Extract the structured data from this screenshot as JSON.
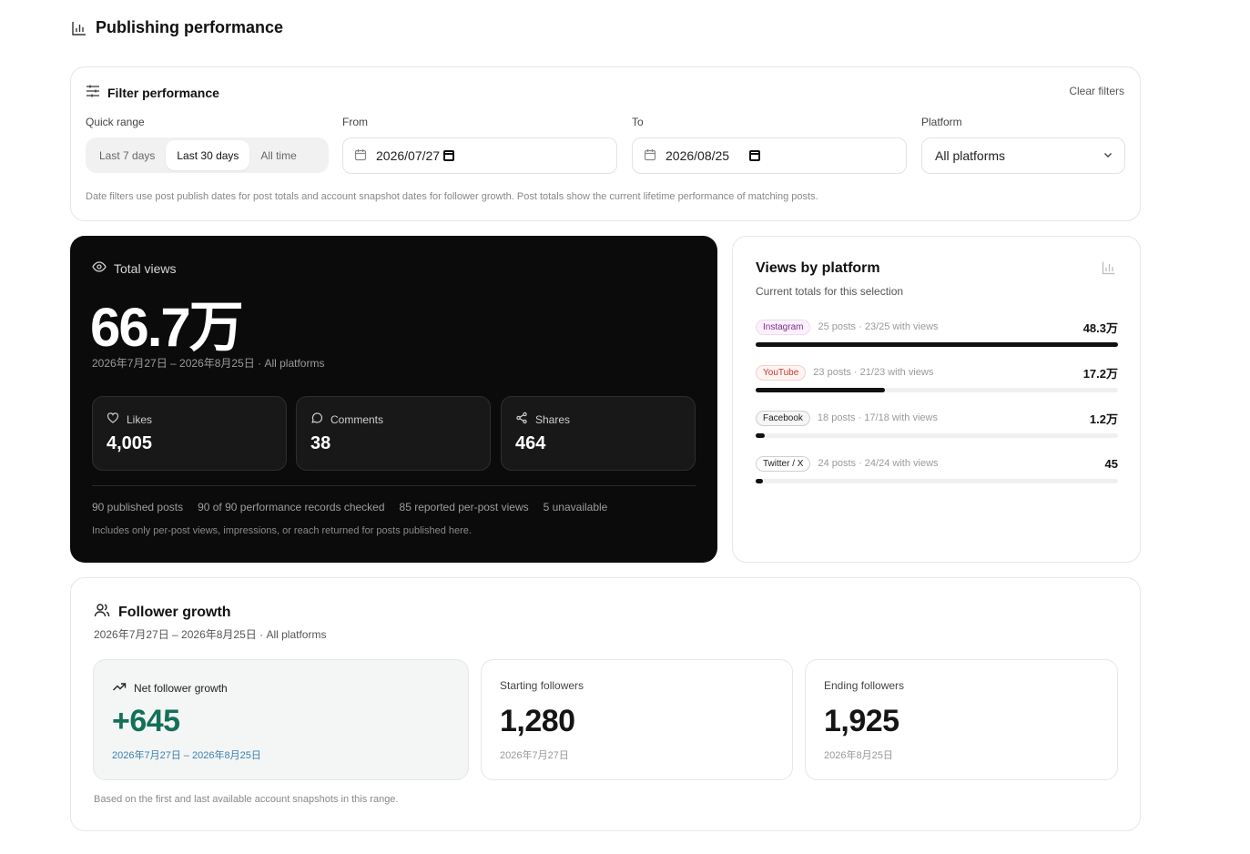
{
  "page": {
    "title": "Publishing performance"
  },
  "filters": {
    "title": "Filter performance",
    "clear_label": "Clear filters",
    "quick_range_label": "Quick range",
    "quick_options": [
      "Last 7 days",
      "Last 30 days",
      "All time"
    ],
    "quick_selected": "Last 30 days",
    "from_label": "From",
    "from_value": "2026/07/27",
    "to_label": "To",
    "to_value": "2026/08/25",
    "platform_label": "Platform",
    "platform_value": "All platforms",
    "note": "Date filters use post publish dates for post totals and account snapshot dates for follower growth. Post totals show the current lifetime performance of matching posts."
  },
  "total_views": {
    "label": "Total views",
    "value": "66.7万",
    "range": "2026年7月27日 – 2026年8月25日 · All platforms",
    "stats": [
      {
        "label": "Likes",
        "value": "4,005",
        "icon": "heart-icon"
      },
      {
        "label": "Comments",
        "value": "38",
        "icon": "comment-icon"
      },
      {
        "label": "Shares",
        "value": "464",
        "icon": "share-icon"
      }
    ],
    "meta": [
      "90 published posts",
      "90 of 90 performance records checked",
      "85 reported per-post views",
      "5 unavailable"
    ],
    "note": "Includes only per-post views, impressions, or reach returned for posts published here."
  },
  "views_by_platform": {
    "title": "Views by platform",
    "subtitle": "Current totals for this selection",
    "rows": [
      {
        "platform": "Instagram",
        "info": "25 posts · 23/25 with views",
        "value": "48.3万",
        "share": 1.0,
        "badge_color": "#7a2e8c",
        "badge_bg": "#fbf1fd",
        "badge_border": "#efd9f3"
      },
      {
        "platform": "YouTube",
        "info": "23 posts · 21/23 with views",
        "value": "17.2万",
        "share": 0.356,
        "badge_color": "#c0392b",
        "badge_bg": "#fff4f2",
        "badge_border": "#f5cfc9"
      },
      {
        "platform": "Facebook",
        "info": "18 posts · 17/18 with views",
        "value": "1.2万",
        "share": 0.025,
        "badge_color": "#222222",
        "badge_bg": "#f6f6f6",
        "badge_border": "#cfcfcf"
      },
      {
        "platform": "Twitter / X",
        "info": "24 posts · 24/24 with views",
        "value": "45",
        "share": 0.02,
        "badge_color": "#222222",
        "badge_bg": "#ffffff",
        "badge_border": "#cfcfcf"
      }
    ]
  },
  "follower_growth": {
    "title": "Follower growth",
    "range": "2026年7月27日 – 2026年8月25日 · All platforms",
    "net": {
      "label": "Net follower growth",
      "value": "+645",
      "sub": "2026年7月27日 – 2026年8月25日"
    },
    "start": {
      "label": "Starting followers",
      "value": "1,280",
      "sub": "2026年7月27日"
    },
    "end": {
      "label": "Ending followers",
      "value": "1,925",
      "sub": "2026年8月25日"
    },
    "note": "Based on the first and last available account snapshots in this range."
  }
}
